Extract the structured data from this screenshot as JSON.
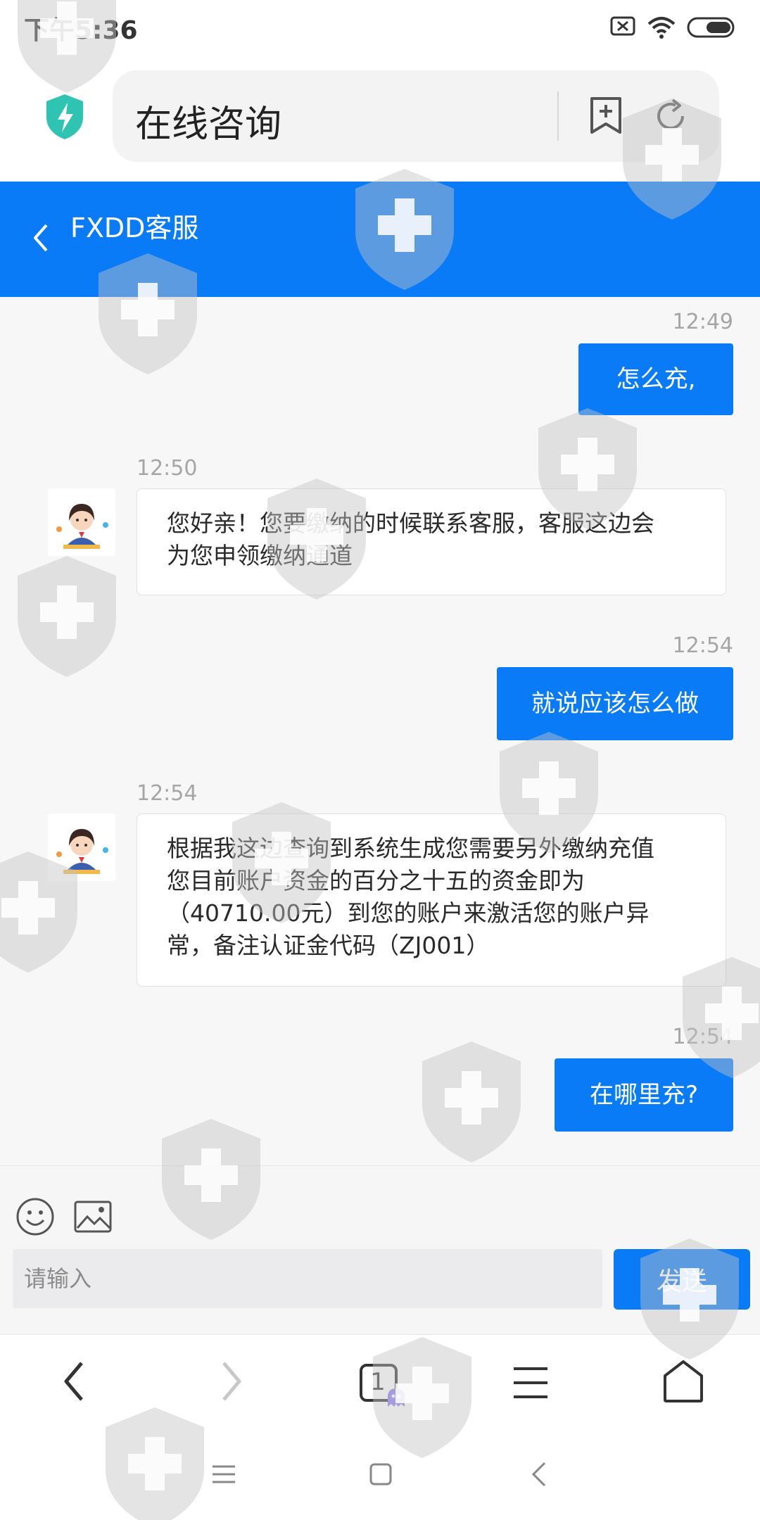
{
  "status_bar": {
    "time": "下午5:36",
    "icons": [
      "sim-off-icon",
      "wifi-icon",
      "battery-icon"
    ]
  },
  "browser": {
    "page_title": "在线咨询",
    "icons": [
      "shield-logo-icon",
      "bookmark-add-icon",
      "refresh-icon"
    ]
  },
  "chat": {
    "title": "FXDD客服",
    "messages": [
      {
        "time": "12:49",
        "from": "me",
        "text": "怎么充,"
      },
      {
        "time": "12:50",
        "from": "agent",
        "lines": [
          "您好亲！您要缴纳的时候联系客服，客服这边会",
          "为您申领缴纳通道"
        ]
      },
      {
        "time": "12:54",
        "from": "me",
        "text": "就说应该怎么做"
      },
      {
        "time": "12:54",
        "from": "agent",
        "lines": [
          "根据我这边查询到系统生成您需要另外缴纳充值",
          "您目前账户资金的百分之十五的资金即为",
          "（40710.00元）到您的账户来激活您的账户异",
          "常，备注认证金代码（ZJ001）"
        ]
      },
      {
        "time": "12:54",
        "from": "me",
        "text": "在哪里充?"
      }
    ]
  },
  "composer": {
    "placeholder": "请输入",
    "send_label": "发送",
    "icons": [
      "emoji-icon",
      "image-icon"
    ]
  },
  "toolbar": {
    "tab_count": "1",
    "icons": [
      "back-icon",
      "forward-icon",
      "tabs-icon",
      "menu-icon",
      "home-icon"
    ]
  },
  "system_nav": {
    "icons": [
      "recents-icon",
      "home-square-icon",
      "system-back-icon"
    ]
  },
  "colors": {
    "accent": "#0a7bf7",
    "shield": "#2fc4b2"
  }
}
